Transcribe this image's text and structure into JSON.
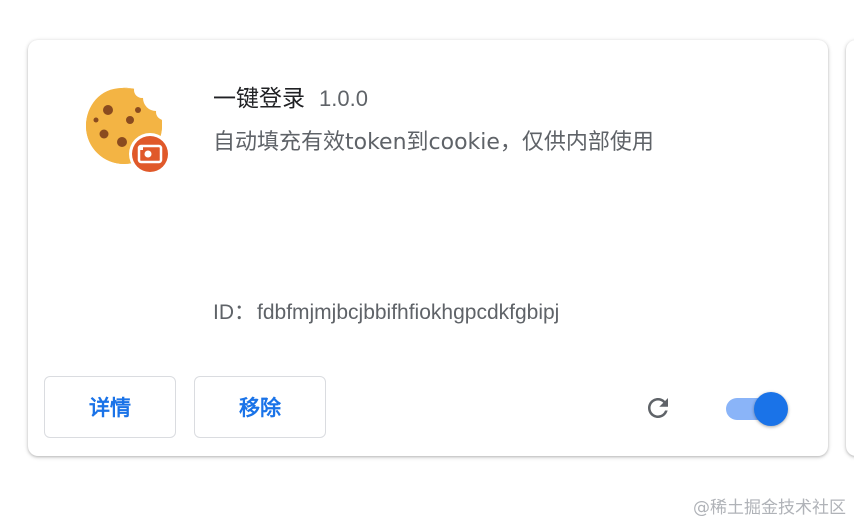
{
  "extension": {
    "name": "一键登录",
    "version": "1.0.0",
    "description": "自动填充有效token到cookie，仅供内部使用",
    "id_label": "ID：",
    "id_value": "fdbfmjmjbcjbbifhfiokhgpcdkfgbipj",
    "icon": "cookie-icon",
    "badge_icon": "cookie-badge-icon",
    "enabled": true
  },
  "actions": {
    "details_label": "详情",
    "remove_label": "移除",
    "reload_icon": "reload-icon"
  },
  "colors": {
    "accent": "#1a73e8",
    "toggle_track": "#8ab4f8",
    "badge": "#e0592a",
    "cookie": "#f3b444"
  },
  "watermark": "@稀土掘金技术社区"
}
